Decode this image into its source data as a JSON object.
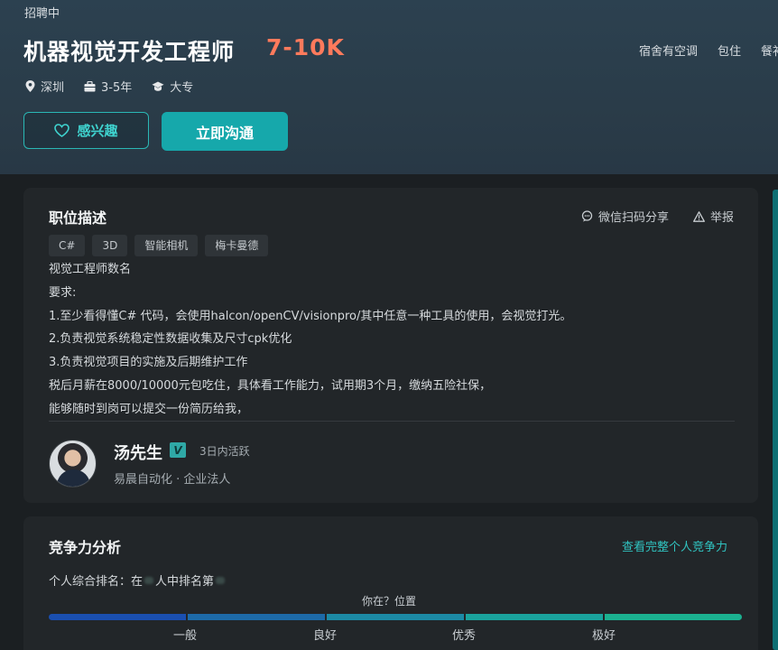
{
  "header": {
    "status": "招聘中",
    "title": "机器视觉开发工程师",
    "salary": "7-10K",
    "meta": {
      "city": "深圳",
      "experience": "3-5年",
      "education": "大专"
    },
    "welfare": [
      "宿舍有空调",
      "包住",
      "餐补"
    ],
    "interest_label": "感兴趣",
    "chat_label": "立即沟通"
  },
  "description": {
    "title": "职位描述",
    "share_label": "微信扫码分享",
    "report_label": "举报",
    "tags": [
      "C#",
      "3D",
      "智能相机",
      "梅卡曼德"
    ],
    "lines": [
      "视觉工程师数名",
      "要求:",
      "1.至少看得懂C# 代码，会使用halcon/openCV/visionpro/其中任意一种工具的使用，会视觉打光。",
      "2.负责视觉系统稳定性数据收集及尺寸cpk优化",
      "3.负责视觉项目的实施及后期维护工作",
      "税后月薪在8000/10000元包吃住，具体看工作能力，试用期3个月，缴纳五险社保，",
      "能够随时到岗可以提交一份简历给我，"
    ],
    "recruiter": {
      "name": "汤先生",
      "verify_badge": "V",
      "active": "3日内活跃",
      "company": "易晨自动化 · 企业法人"
    }
  },
  "competitiveness": {
    "title": "竞争力分析",
    "link_label": "查看完整个人竞争力",
    "rank_prefix": "个人综合排名：在",
    "rank_middle": "人中排名第",
    "position_label": "你在？位置",
    "levels": [
      "一般",
      "良好",
      "优秀",
      "极好"
    ],
    "colors": [
      "#1a4fb0",
      "#1d6aa8",
      "#1c8aa5",
      "#1aa39d",
      "#1bb190"
    ]
  }
}
